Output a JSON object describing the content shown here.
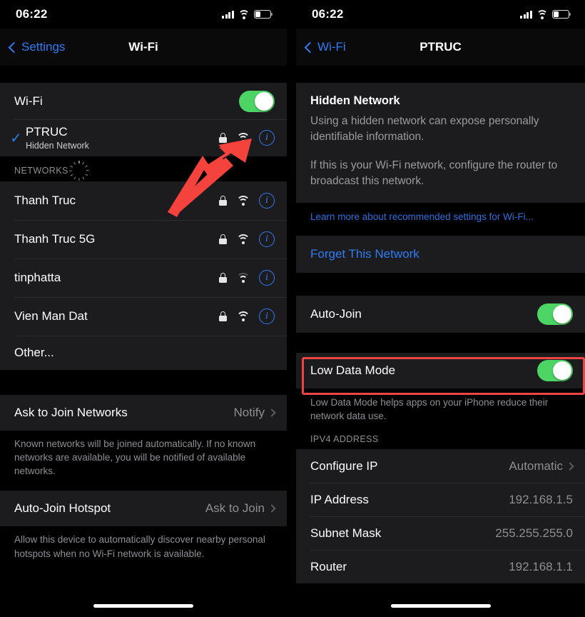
{
  "left": {
    "statusbar": {
      "time": "06:22",
      "signal_icon": "cellular-signal-icon",
      "wifi_icon": "wifi-icon",
      "battery_icon": "battery-icon",
      "battery_level": 32
    },
    "nav": {
      "back_label": "Settings",
      "title": "Wi-Fi",
      "back_icon": "chevron-left-icon"
    },
    "wifi_toggle": {
      "label": "Wi-Fi",
      "state": "on"
    },
    "connected": {
      "name": "PTRUC",
      "subtitle": "Hidden Network",
      "check_icon": "checkmark-icon",
      "lock_icon": "lock-icon",
      "wifi_icon": "wifi-icon",
      "info_icon": "info-circle-icon"
    },
    "networks_header": {
      "label": "NETWORKS",
      "spinner_icon": "activity-spinner-icon"
    },
    "networks": [
      {
        "name": "Thanh Truc",
        "secured": true,
        "signal": "strong"
      },
      {
        "name": "Thanh Truc 5G",
        "secured": true,
        "signal": "strong"
      },
      {
        "name": "tinphatta",
        "secured": true,
        "signal": "weak"
      },
      {
        "name": "Vien Man Dat",
        "secured": true,
        "signal": "strong"
      }
    ],
    "other_label": "Other...",
    "ask_to_join": {
      "label": "Ask to Join Networks",
      "value": "Notify",
      "chevron_icon": "chevron-right-icon"
    },
    "ask_to_join_footnote": "Known networks will be joined automatically. If no known networks are available, you will be notified of available networks.",
    "auto_join_hotspot": {
      "label": "Auto-Join Hotspot",
      "value": "Ask to Join",
      "chevron_icon": "chevron-right-icon"
    },
    "auto_join_hotspot_footnote": "Allow this device to automatically discover nearby personal hotspots when no Wi-Fi network is available."
  },
  "right": {
    "statusbar": {
      "time": "06:22",
      "signal_icon": "cellular-signal-icon",
      "wifi_icon": "wifi-icon",
      "battery_icon": "battery-icon",
      "battery_level": 32
    },
    "nav": {
      "back_label": "Wi-Fi",
      "title": "PTRUC",
      "back_icon": "chevron-left-icon"
    },
    "hidden_network": {
      "title": "Hidden Network",
      "p1": "Using a hidden network can expose personally identifiable information.",
      "p2": "If this is your Wi-Fi network, configure the router to broadcast this network."
    },
    "learn_more": "Learn more about recommended settings for Wi-Fi...",
    "forget_network": "Forget This Network",
    "auto_join": {
      "label": "Auto-Join",
      "state": "on"
    },
    "low_data_mode": {
      "label": "Low Data Mode",
      "state": "on"
    },
    "low_data_footnote": "Low Data Mode helps apps on your iPhone reduce their network data use.",
    "ipv4_header": "IPV4 ADDRESS",
    "ipv4_rows": [
      {
        "label": "Configure IP",
        "value": "Automatic",
        "chevron": true
      },
      {
        "label": "IP Address",
        "value": "192.168.1.5",
        "chevron": false
      },
      {
        "label": "Subnet Mask",
        "value": "255.255.255.0",
        "chevron": false
      },
      {
        "label": "Router",
        "value": "192.168.1.1",
        "chevron": false
      }
    ]
  },
  "annotations": {
    "arrow": {
      "icon": "red-arrow-annotation",
      "color": "#f4433c",
      "points_to": "info-circle-icon of PTRUC row"
    },
    "highlight_box": {
      "icon": "red-rectangle-annotation",
      "color": "#ef4444",
      "surrounds": "Low Data Mode row"
    }
  },
  "colors": {
    "accent_blue": "#2f7cf6",
    "toggle_green": "#4cd464",
    "row_bg": "#1c1c1e",
    "page_bg": "#000000",
    "secondary_text": "#8e8e93",
    "annotation_red": "#ef4444"
  }
}
